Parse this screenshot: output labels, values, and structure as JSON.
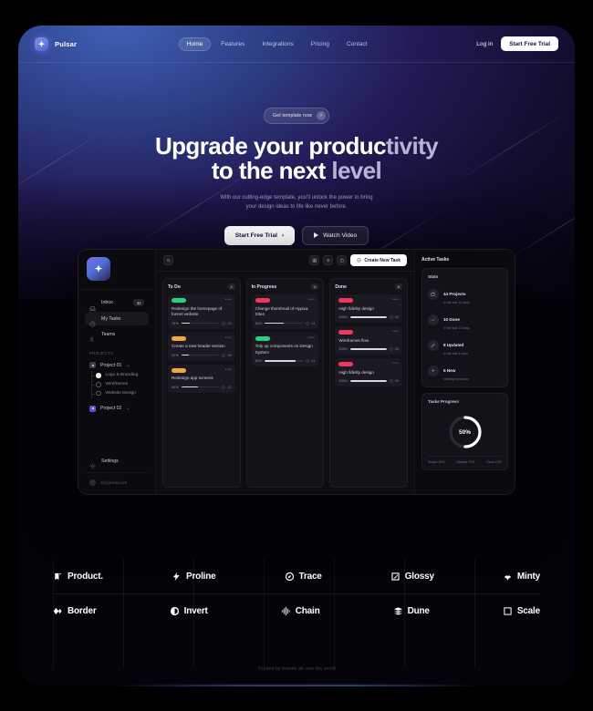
{
  "nav": {
    "brand": "Pulsar",
    "links": [
      {
        "label": "Home",
        "active": true
      },
      {
        "label": "Features",
        "active": false
      },
      {
        "label": "Integrations",
        "active": false
      },
      {
        "label": "Pricing",
        "active": false
      },
      {
        "label": "Contact",
        "active": false
      }
    ],
    "login_label": "Log in",
    "trial_label": "Start Free Trial"
  },
  "hero": {
    "pill_text": "Get template now",
    "headline_line1_strong": "Upgrade your produc",
    "headline_line1_dim": "tivity",
    "headline_line2_strong": "to the next ",
    "headline_line2_dim": "level",
    "subtitle_line1": "With our cutting-edge template, you'll unlock the power to bring",
    "subtitle_line2": "your design ideas to life like never before.",
    "cta_primary": "Start Free Trial",
    "cta_primary_arrow": "›",
    "cta_secondary": "Watch Video"
  },
  "dashboard": {
    "sidebar": {
      "items": [
        {
          "label": "Inbox",
          "badge": "32",
          "active": false,
          "icon": "inbox-icon"
        },
        {
          "label": "My Tasks",
          "badge": "",
          "active": true,
          "icon": "clock-icon"
        },
        {
          "label": "Teams",
          "badge": "",
          "active": false,
          "icon": "people-icon"
        }
      ],
      "section_label": "PROJECTS",
      "project_01": "Project 01",
      "project_01_subitems": [
        {
          "label": "Logo & Branding",
          "checked": true
        },
        {
          "label": "Wireframes",
          "checked": false
        },
        {
          "label": "Website Design",
          "checked": false
        }
      ],
      "project_02": "Project 02",
      "settings_label": "Settings",
      "email": "info@mail.com",
      "caret": "⌄"
    },
    "toolbar": {
      "create_task_label": "Create New Task"
    },
    "columns": [
      {
        "title": "To Do",
        "count": "4",
        "cards": [
          {
            "tag": "green",
            "title": "Redesign the homepage of funnel website",
            "pct": "75%",
            "progress": 22,
            "meta": "03"
          },
          {
            "tag": "amber",
            "title": "Create a new header section",
            "pct": "20%",
            "progress": 20,
            "meta": "08"
          },
          {
            "tag": "amber",
            "title": "Redesign app screens",
            "pct": "45%",
            "progress": 45,
            "meta": "12"
          }
        ]
      },
      {
        "title": "In Progress",
        "count": "6",
        "cards": [
          {
            "tag": "red",
            "title": "Change thumbnail of Hypixa Sites",
            "pct": "50%",
            "progress": 50,
            "meta": "14"
          },
          {
            "tag": "green",
            "title": "Tidy up components on Design System",
            "pct": "80%",
            "progress": 80,
            "meta": "24"
          }
        ]
      },
      {
        "title": "Done",
        "count": "8",
        "cards": [
          {
            "tag": "red",
            "title": "High fidelity design",
            "pct": "100%",
            "progress": 100,
            "meta": "04"
          },
          {
            "tag": "red",
            "title": "Wireframes flow",
            "pct": "100%",
            "progress": 100,
            "meta": "06"
          },
          {
            "tag": "red",
            "title": "High fidelity design",
            "pct": "100%",
            "progress": 100,
            "meta": "09"
          }
        ]
      }
    ],
    "right_panel": {
      "title": "Active Tasks",
      "stats_title": "Stats",
      "stats": [
        {
          "value": "44 Projects",
          "sub": "in the last 14 days",
          "icon": "briefcase-icon"
        },
        {
          "value": "10 Done",
          "sub": "in the last 10 days",
          "icon": "check-icon"
        },
        {
          "value": "8 Updated",
          "sub": "in the last 5 days",
          "icon": "pen-icon"
        },
        {
          "value": "5 New",
          "sub": "starting tomorrow",
          "icon": "plus-icon"
        }
      ],
      "progress_title": "Tasks Progress",
      "progress_value": "50%",
      "progress_percent": 50,
      "legend": [
        {
          "label": "Scope",
          "value": "18%"
        },
        {
          "label": "Started",
          "value": "70%"
        },
        {
          "label": "Done",
          "value": "22%"
        }
      ]
    }
  },
  "logos": {
    "row1": [
      {
        "name": "Product.",
        "icon": "bookmark-icon"
      },
      {
        "name": "Proline",
        "icon": "bolt-icon"
      },
      {
        "name": "Trace",
        "icon": "compass-icon"
      },
      {
        "name": "Glossy",
        "icon": "frame-icon"
      },
      {
        "name": "Minty",
        "icon": "leaf-icon"
      }
    ],
    "row2": [
      {
        "name": "Border",
        "icon": "diamond-icon"
      },
      {
        "name": "Invert",
        "icon": "half-circle-icon"
      },
      {
        "name": "Chain",
        "icon": "waveform-icon"
      },
      {
        "name": "Dune",
        "icon": "layers-icon"
      },
      {
        "name": "Scale",
        "icon": "expand-icon"
      }
    ],
    "trusted_text": "Trusted by brands all over the world"
  },
  "colors": {
    "accent_white": "#ffffff",
    "tag_green": "#2fd27a",
    "tag_red": "#f2385a",
    "tag_amber": "#f0a93b",
    "brand_purple": "#6d4ad6"
  }
}
